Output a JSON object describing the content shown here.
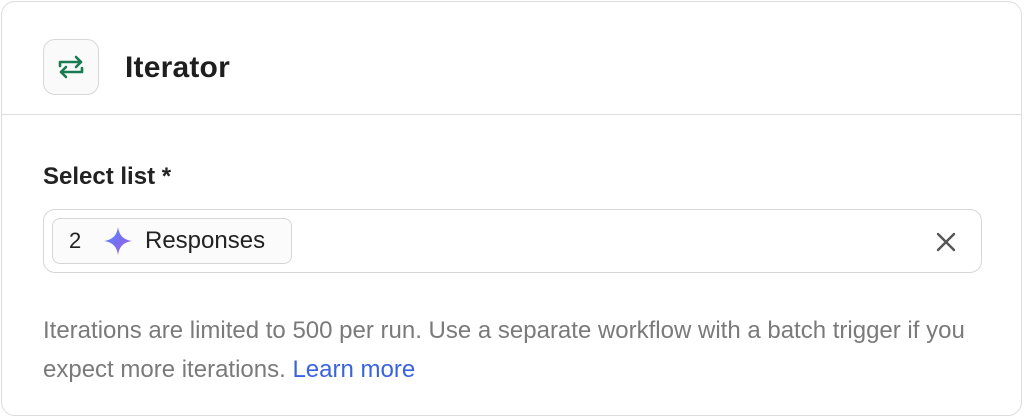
{
  "header": {
    "icon": "repeat-arrows-icon",
    "title": "Iterator"
  },
  "field": {
    "label": "Select list *",
    "chip": {
      "number": "2",
      "icon": "sparkle-icon",
      "label": "Responses"
    },
    "clear_icon": "close-icon"
  },
  "help": {
    "text": "Iterations are limited to 500 per run. Use a separate workflow with a batch trigger if you expect more iterations.",
    "link_label": "Learn more"
  },
  "colors": {
    "icon_green": "#1a7a52",
    "link_blue": "#3b63e0",
    "help_gray": "#7a7a7a"
  }
}
